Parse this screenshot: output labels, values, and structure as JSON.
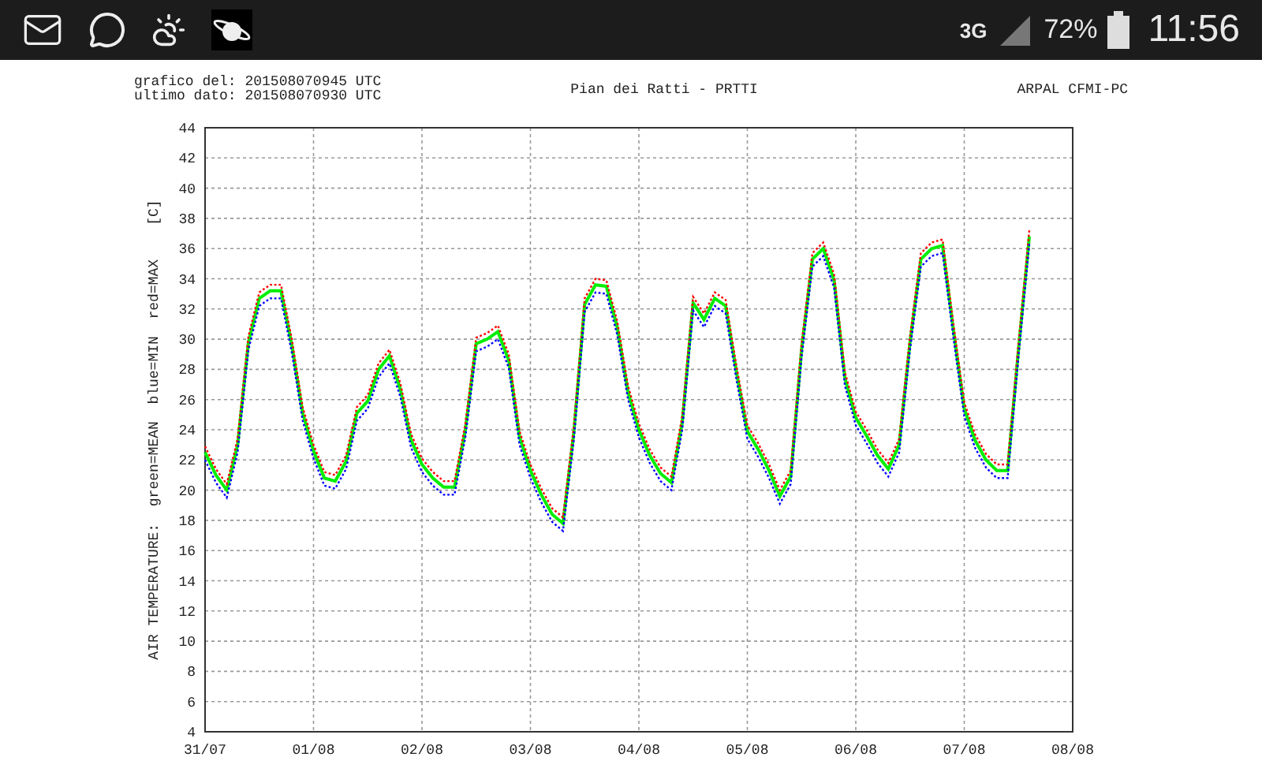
{
  "status_bar": {
    "network": "3G",
    "battery": "72%",
    "time": "11:56"
  },
  "chart": {
    "generated": "grafico del: 201508070945 UTC",
    "last_data": "ultimo dato: 201508070930 UTC",
    "source": "ARPAL CFMI-PC",
    "y_unit": "[C]",
    "chart_data": {
      "type": "line",
      "title": "Pian dei Ratti - PRTTI",
      "ylabel": "AIR TEMPERATURE:",
      "ylim": [
        4,
        44
      ],
      "grid": true,
      "yticks": [
        4,
        6,
        8,
        10,
        12,
        14,
        16,
        18,
        20,
        22,
        24,
        26,
        28,
        30,
        32,
        34,
        36,
        38,
        40,
        42,
        44
      ],
      "categories": [
        "31/07",
        null,
        null,
        null,
        null,
        null,
        null,
        null,
        null,
        null,
        "01/08",
        null,
        null,
        null,
        null,
        null,
        null,
        null,
        null,
        null,
        "02/08",
        null,
        null,
        null,
        null,
        null,
        null,
        null,
        null,
        null,
        "03/08",
        null,
        null,
        null,
        null,
        null,
        null,
        null,
        null,
        null,
        "04/08",
        null,
        null,
        null,
        null,
        null,
        null,
        null,
        null,
        null,
        "05/08",
        null,
        null,
        null,
        null,
        null,
        null,
        null,
        null,
        null,
        "06/08",
        null,
        null,
        null,
        null,
        null,
        null,
        null,
        null,
        null,
        "07/08",
        null,
        null,
        null,
        null,
        null,
        null,
        null,
        null,
        null,
        "08/08"
      ],
      "series": [
        {
          "name": "red=MAX",
          "color": "#ff0000",
          "line_style": "dotted",
          "values": [
            22.9,
            21.4,
            20.4,
            23.4,
            30.2,
            33.1,
            33.6,
            33.6,
            30.0,
            25.5,
            23.0,
            21.2,
            21.0,
            22.3,
            25.5,
            26.3,
            28.4,
            29.3,
            27.1,
            23.7,
            22.1,
            21.2,
            20.6,
            20.6,
            24.4,
            30.1,
            30.4,
            30.9,
            29.0,
            23.9,
            21.7,
            20.1,
            18.8,
            18.2,
            24.2,
            32.7,
            34.0,
            33.9,
            31.2,
            26.9,
            24.4,
            22.7,
            21.5,
            20.9,
            24.9,
            32.8,
            31.7,
            33.1,
            32.6,
            28.2,
            24.3,
            23.1,
            21.7,
            20.0,
            21.3,
            29.7,
            35.7,
            36.4,
            34.3,
            27.8,
            25.2,
            24.0,
            22.7,
            21.8,
            23.4,
            30.2,
            35.7,
            36.4,
            36.6,
            31.0,
            25.8,
            23.7,
            22.4,
            21.7,
            21.7,
            29.7,
            37.2,
            null,
            null,
            null,
            null
          ]
        },
        {
          "name": "blue=MIN",
          "color": "#0000ff",
          "line_style": "dotted",
          "values": [
            22.0,
            20.5,
            19.5,
            22.5,
            29.3,
            32.2,
            32.7,
            32.7,
            29.1,
            24.6,
            22.1,
            20.3,
            20.1,
            21.4,
            24.6,
            25.4,
            27.5,
            28.4,
            26.2,
            22.8,
            21.2,
            20.3,
            19.7,
            19.7,
            23.5,
            29.2,
            29.5,
            30.0,
            28.1,
            23.0,
            20.8,
            19.2,
            17.9,
            17.3,
            23.3,
            31.8,
            33.1,
            33.0,
            30.3,
            26.0,
            23.5,
            21.8,
            20.6,
            20.0,
            24.0,
            31.9,
            30.8,
            32.2,
            31.7,
            27.3,
            23.4,
            22.2,
            20.8,
            19.1,
            20.4,
            28.8,
            34.8,
            35.5,
            33.4,
            26.9,
            24.3,
            23.1,
            21.8,
            20.9,
            22.5,
            29.3,
            34.8,
            35.5,
            35.7,
            30.1,
            24.9,
            22.8,
            21.5,
            20.8,
            20.8,
            28.8,
            36.3,
            null,
            null,
            null,
            null
          ]
        },
        {
          "name": "green=MEAN",
          "color": "#00ee00",
          "line_style": "solid",
          "values": [
            22.5,
            21.0,
            20.0,
            23.0,
            29.8,
            32.7,
            33.2,
            33.2,
            29.6,
            25.1,
            22.6,
            20.8,
            20.6,
            21.9,
            25.1,
            25.9,
            28.0,
            28.9,
            26.7,
            23.3,
            21.7,
            20.8,
            20.2,
            20.2,
            24.0,
            29.7,
            30.0,
            30.5,
            28.6,
            23.5,
            21.3,
            19.7,
            18.4,
            17.8,
            23.8,
            32.3,
            33.6,
            33.5,
            30.8,
            26.5,
            24.0,
            22.3,
            21.1,
            20.5,
            24.5,
            32.4,
            31.3,
            32.7,
            32.2,
            27.8,
            23.9,
            22.7,
            21.3,
            19.6,
            20.9,
            29.3,
            35.3,
            36.0,
            33.9,
            27.4,
            24.8,
            23.6,
            22.3,
            21.4,
            23.0,
            29.8,
            35.3,
            36.0,
            36.2,
            30.6,
            25.4,
            23.3,
            22.0,
            21.3,
            21.3,
            29.3,
            36.8,
            null,
            null,
            null,
            null
          ]
        }
      ]
    }
  }
}
